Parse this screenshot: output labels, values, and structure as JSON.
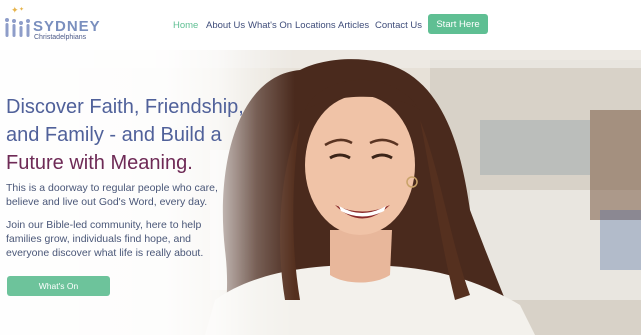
{
  "logo": {
    "name": "SYDNEY",
    "subtitle": "Christadelphians"
  },
  "nav": {
    "items": [
      {
        "label": "Home",
        "active": true
      },
      {
        "label": "About Us"
      },
      {
        "label": "What's On"
      },
      {
        "label": "Locations"
      },
      {
        "label": "Articles"
      },
      {
        "label": "Contact Us"
      }
    ],
    "cta_label": "Start Here"
  },
  "hero": {
    "headline_part1": "Discover Faith, Friendship, and Family - and Build a",
    "headline_accent": "Future with Meaning.",
    "paragraph1": "This is a doorway to regular people who care, believe and live out God's Word, every day.",
    "paragraph2": "Join our Bible-led community, here to help families grow, individuals find hope, and everyone discover what life is really about.",
    "button_label": "What's On"
  },
  "colors": {
    "brand_green": "#5fbf93",
    "heading_blue": "#50619a",
    "accent_plum": "#6e2a56",
    "nav_text": "#3f4d7a"
  }
}
